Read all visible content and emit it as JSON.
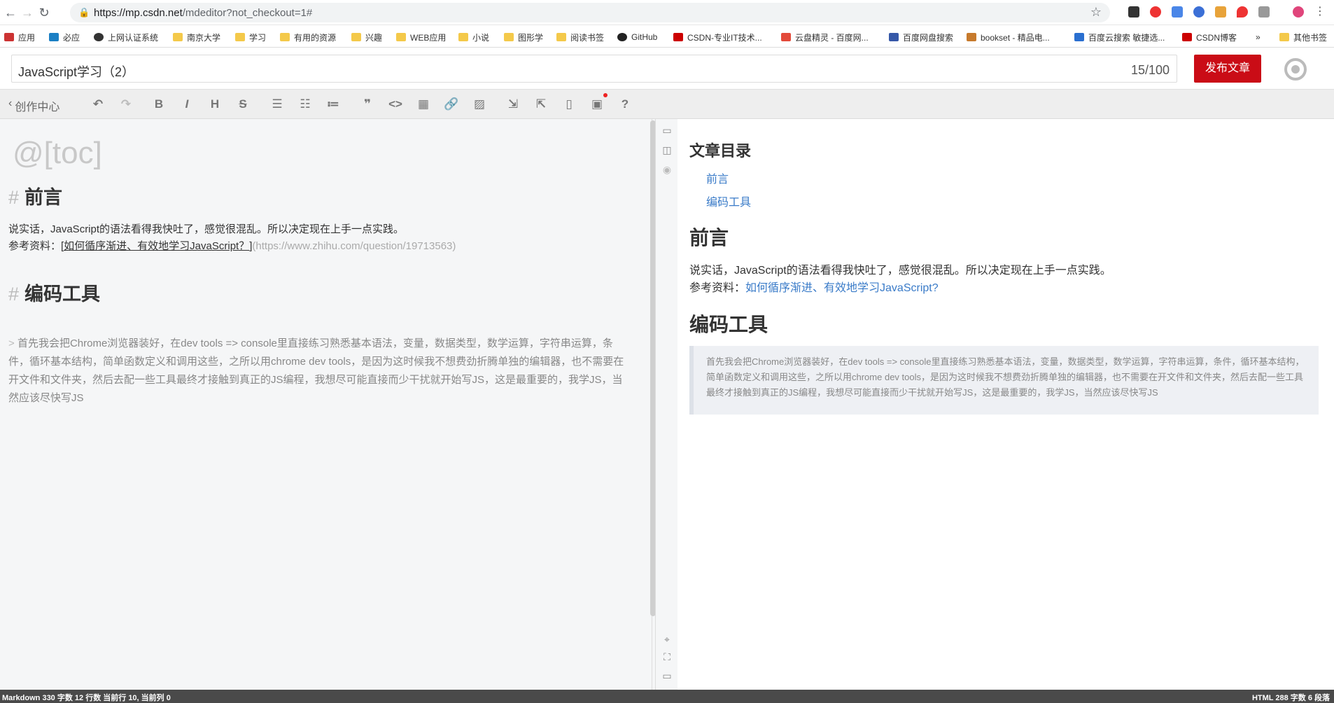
{
  "browser": {
    "url_host": "https://mp.csdn.net",
    "url_path": "/mdeditor?not_checkout=1#"
  },
  "bookmarks": [
    {
      "label": "应用",
      "icon": "apps-grid-icon"
    },
    {
      "label": "必应",
      "icon": "bing-icon"
    },
    {
      "label": "上网认证系统",
      "icon": "globe-icon"
    },
    {
      "label": "南京大学",
      "icon": "folder-icon"
    },
    {
      "label": "学习",
      "icon": "folder-icon"
    },
    {
      "label": "有用的资源",
      "icon": "folder-icon"
    },
    {
      "label": "兴趣",
      "icon": "folder-icon"
    },
    {
      "label": "WEB应用",
      "icon": "folder-icon"
    },
    {
      "label": "小说",
      "icon": "folder-icon"
    },
    {
      "label": "图形学",
      "icon": "folder-icon"
    },
    {
      "label": "阅读书签",
      "icon": "folder-icon"
    },
    {
      "label": "GitHub",
      "icon": "github-icon"
    },
    {
      "label": "CSDN-专业IT技术...",
      "icon": "csdn-icon"
    },
    {
      "label": "云盘精灵 - 百度网...",
      "icon": "cloud-icon"
    },
    {
      "label": "百度网盘搜索",
      "icon": "search-site-icon"
    },
    {
      "label": "bookset - 精品电...",
      "icon": "book-icon"
    },
    {
      "label": "百度云搜索 敏捷选...",
      "icon": "ling-icon"
    },
    {
      "label": "CSDN博客",
      "icon": "csdn-icon"
    },
    {
      "label": "»",
      "icon": ""
    },
    {
      "label": "其他书签",
      "icon": "folder-icon"
    }
  ],
  "editor": {
    "title": "JavaScript学习（2）",
    "title_count": "15/100",
    "publish_label": "发布文章",
    "back_label": "创作中心",
    "md": {
      "toc": "@[toc]",
      "h1": "前言",
      "p1": "说实话，JavaScript的语法看得我快吐了，感觉很混乱。所以决定现在上手一点实践。",
      "ref_label": "参考资料：",
      "ref_link_text": "[如何循序渐进、有效地学习JavaScript？]",
      "ref_link_url": "(https://www.zhihu.com/question/19713563)",
      "h2": "编码工具",
      "quote_marker": ">",
      "quote": "首先我会把Chrome浏览器装好，在dev tools => console里直接练习熟悉基本语法，变量，数据类型，数学运算，字符串运算，条件，循环基本结构，简单函数定义和调用这些，之所以用chrome dev tools，是因为这时候我不想费劲折腾单独的编辑器，也不需要在开文件和文件夹，然后去配一些工具最终才接触到真正的JS编程，我想尽可能直接而少干扰就开始写JS，这是最重要的，我学JS，当然应该尽快写JS"
    }
  },
  "preview": {
    "toc_title": "文章目录",
    "toc_items": [
      "前言",
      "编码工具"
    ],
    "h1": "前言",
    "p1": "说实话，JavaScript的语法看得我快吐了，感觉很混乱。所以决定现在上手一点实践。",
    "ref_label": "参考资料：",
    "ref_link": "如何循序渐进、有效地学习JavaScript?",
    "h2": "编码工具",
    "quote": "首先我会把Chrome浏览器装好，在dev tools => console里直接练习熟悉基本语法，变量，数据类型，数学运算，字符串运算，条件，循环基本结构，简单函数定义和调用这些，之所以用chrome dev tools，是因为这时候我不想费劲折腾单独的编辑器，也不需要在开文件和文件夹，然后去配一些工具最终才接触到真正的JS编程，我想尽可能直接而少干扰就开始写JS，这是最重要的，我学JS，当然应该尽快写JS"
  },
  "status": {
    "left": "Markdown  330 字数  12 行数  当前行 10, 当前列 0",
    "right": "HTML  288 字数  6 段落"
  },
  "colors": {
    "publish": "#ca0c16",
    "link": "#3a7bc8"
  }
}
